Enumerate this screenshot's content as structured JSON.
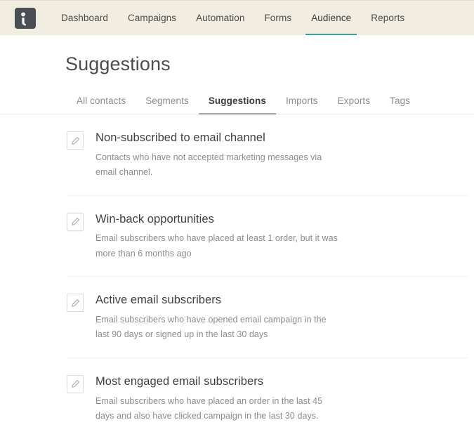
{
  "header": {
    "logo_icon": "brand-person-logo",
    "nav": [
      {
        "label": "Dashboard",
        "active": false
      },
      {
        "label": "Campaigns",
        "active": false
      },
      {
        "label": "Automation",
        "active": false
      },
      {
        "label": "Forms",
        "active": false
      },
      {
        "label": "Audience",
        "active": true
      },
      {
        "label": "Reports",
        "active": false
      }
    ],
    "accent_color": "#3fa39a",
    "background_color": "#f2ede1"
  },
  "page": {
    "title": "Suggestions"
  },
  "subtabs": [
    {
      "label": "All contacts",
      "active": false
    },
    {
      "label": "Segments",
      "active": false
    },
    {
      "label": "Suggestions",
      "active": true
    },
    {
      "label": "Imports",
      "active": false
    },
    {
      "label": "Exports",
      "active": false
    },
    {
      "label": "Tags",
      "active": false
    }
  ],
  "suggestions": [
    {
      "icon": "pencil-edit-icon",
      "title": "Non-subscribed to email channel",
      "description": "Contacts who have not accepted marketing messages via email channel."
    },
    {
      "icon": "pencil-edit-icon",
      "title": "Win-back opportunities",
      "description": "Email subscribers who have placed at least 1 order, but it was more than 6 months ago"
    },
    {
      "icon": "pencil-edit-icon",
      "title": "Active email subscribers",
      "description": "Email subscribers who have opened email campaign in the last 90 days or signed up in the last 30 days"
    },
    {
      "icon": "pencil-edit-icon",
      "title": "Most engaged email subscribers",
      "description": "Email subscribers who have placed an order in the last 45 days and also have clicked campaign in the last 30 days."
    }
  ]
}
